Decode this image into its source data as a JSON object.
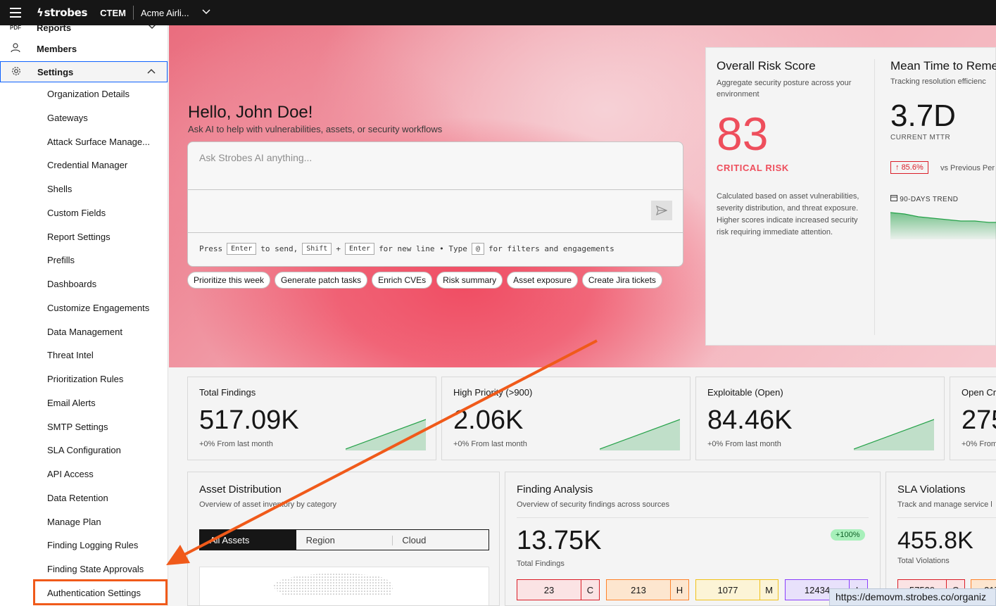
{
  "topbar": {
    "logo": "strobes",
    "product": "CTEM",
    "org": "Acme Airli..."
  },
  "sidebar": {
    "reports": "Reports",
    "members": "Members",
    "settings": "Settings",
    "settings_items": [
      "Organization Details",
      "Gateways",
      "Attack Surface Manage...",
      "Credential Manager",
      "Shells",
      "Custom Fields",
      "Report Settings",
      "Prefills",
      "Dashboards",
      "Customize Engagements",
      "Data Management",
      "Threat Intel",
      "Prioritization Rules",
      "Email Alerts",
      "SMTP Settings",
      "SLA Configuration",
      "API Access",
      "Data Retention",
      "Manage Plan",
      "Finding Logging Rules",
      "Finding State Approvals",
      "Authentication Settings"
    ]
  },
  "hero": {
    "greeting": "Hello, John Doe!",
    "subtitle": "Ask AI to help with vulnerabilities, assets, or security workflows",
    "placeholder": "Ask Strobes AI anything...",
    "hint": {
      "press": "Press",
      "enter": "Enter",
      "to_send": "to send,",
      "shift": "Shift",
      "plus": "+",
      "enter2": "Enter",
      "new_line": "for new line • Type",
      "at": "@",
      "filters": "for filters and engagements"
    },
    "chips": [
      "Prioritize this week",
      "Generate patch tasks",
      "Enrich CVEs",
      "Risk summary",
      "Asset exposure",
      "Create Jira tickets"
    ]
  },
  "risk": {
    "title": "Overall Risk Score",
    "subtitle": "Aggregate security posture across your environment",
    "score": "83",
    "label": "CRITICAL RISK",
    "description": "Calculated based on asset vulnerabilities, severity distribution, and threat exposure. Higher scores indicate increased security risk requiring immediate attention."
  },
  "mttr": {
    "title": "Mean Time to Reme",
    "subtitle": "Tracking resolution efficienc",
    "value": "3.7D",
    "caption": "CURRENT MTTR",
    "change": "85.6%",
    "vs": "vs Previous Per",
    "trend_label": "90-DAYS TREND"
  },
  "stats": [
    {
      "title": "Total Findings",
      "value": "517.09K",
      "sub": "+0% From last month"
    },
    {
      "title": "High Priority (>900)",
      "value": "2.06K",
      "sub": "+0% From last month"
    },
    {
      "title": "Exploitable (Open)",
      "value": "84.46K",
      "sub": "+0% From last month"
    },
    {
      "title": "Open Cri",
      "value": "275",
      "sub": "+0% From"
    }
  ],
  "asset_distribution": {
    "title": "Asset Distribution",
    "subtitle": "Overview of asset inventory by category",
    "tabs": [
      "All Assets",
      "Region",
      "Cloud"
    ]
  },
  "finding_analysis": {
    "title": "Finding Analysis",
    "subtitle": "Overview of security findings across sources",
    "value": "13.75K",
    "label": "Total Findings",
    "badge": "+100%",
    "severities": [
      {
        "count": "23",
        "letter": "C"
      },
      {
        "count": "213",
        "letter": "H"
      },
      {
        "count": "1077",
        "letter": "M"
      },
      {
        "count": "12434",
        "letter": "L"
      }
    ]
  },
  "sla": {
    "title": "SLA Violations",
    "subtitle": "Track and manage service l",
    "value": "455.8K",
    "label": "Total Violations",
    "sev1": "57539",
    "sev1_letter": "C",
    "sev2": "217"
  },
  "status_url": "https://demovm.strobes.co/organiz",
  "colors": {
    "accent_orange": "#f05a1a",
    "critical_red": "#ee4e5c",
    "topbar": "#161616",
    "trend_green": "#24a148"
  }
}
